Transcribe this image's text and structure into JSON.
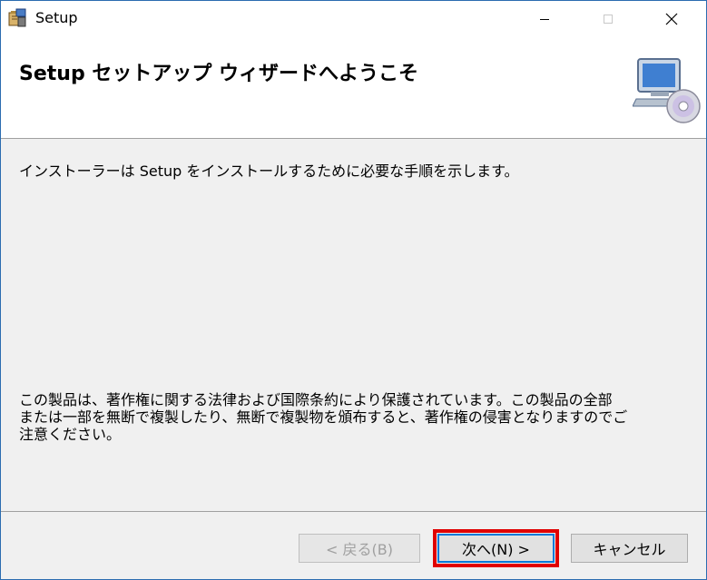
{
  "window": {
    "title": "Setup",
    "controls": {
      "minimize": "minimize",
      "maximize": "maximize",
      "close": "close"
    }
  },
  "header": {
    "title": "Setup セットアップ ウィザードへようこそ"
  },
  "content": {
    "intro": "インストーラーは Setup をインストールするために必要な手順を示します。",
    "copyright_lines": [
      "この製品は、著作権に関する法律および国際条約により保護されています。この製品の全部",
      "または一部を無断で複製したり、無断で複製物を頒布すると、著作権の侵害となりますのでご",
      "注意ください。"
    ]
  },
  "buttons": {
    "back": "< 戻る(B)",
    "next": "次へ(N) >",
    "cancel": "キャンセル"
  },
  "colors": {
    "highlight": "#e00000",
    "focus": "#0078d7",
    "panel_bg": "#f0f0f0"
  }
}
